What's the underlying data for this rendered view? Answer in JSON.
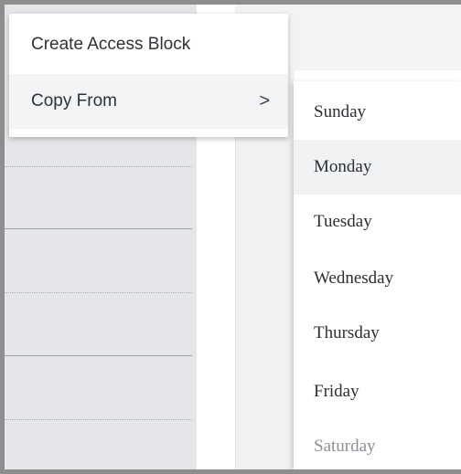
{
  "context_menu": {
    "items": [
      {
        "label": "Create Access Block"
      },
      {
        "label": "Copy From",
        "submenu_indicator": ">"
      }
    ]
  },
  "submenu": {
    "items": [
      {
        "label": "Sunday"
      },
      {
        "label": "Monday",
        "state": "hovered"
      },
      {
        "label": "Tuesday"
      },
      {
        "label": "Wednesday"
      },
      {
        "label": "Thursday"
      },
      {
        "label": "Friday"
      },
      {
        "label": "Saturday",
        "state": "disabled"
      }
    ]
  },
  "colors": {
    "menu_text": "#2f3237",
    "hover_background": "#f1f2f4",
    "disabled_text": "#8d9096"
  }
}
